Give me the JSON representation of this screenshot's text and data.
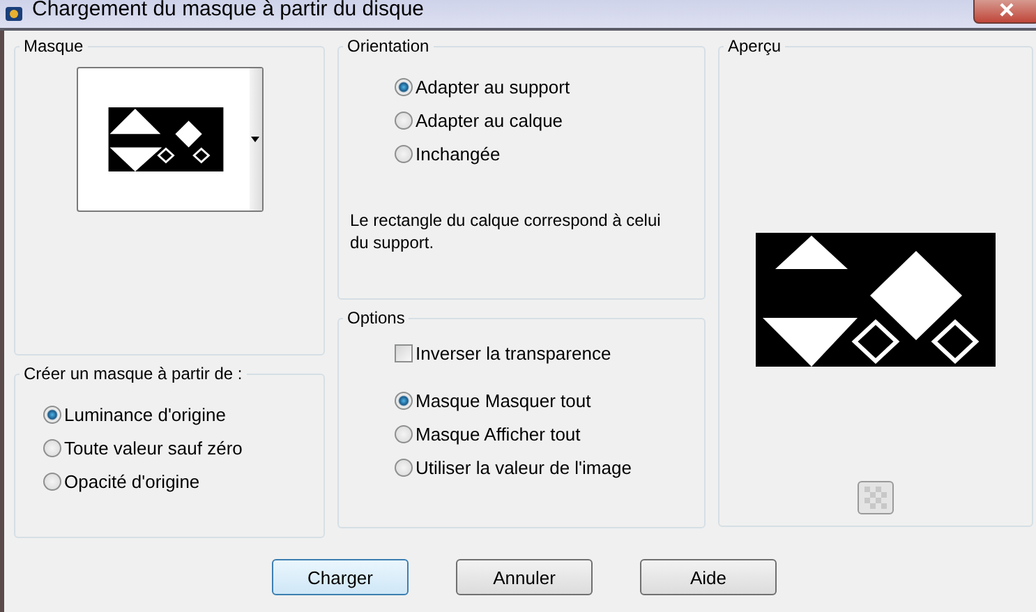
{
  "window": {
    "title": "Chargement du masque à partir du disque"
  },
  "mask": {
    "title": "Masque"
  },
  "source": {
    "title": "Créer un masque à partir de :",
    "options": [
      {
        "label": "Luminance d'origine",
        "selected": true
      },
      {
        "label": "Toute valeur sauf zéro",
        "selected": false
      },
      {
        "label": "Opacité d'origine",
        "selected": false
      }
    ]
  },
  "orientation": {
    "title": "Orientation",
    "options": [
      {
        "label": "Adapter au support",
        "selected": true
      },
      {
        "label": "Adapter au calque",
        "selected": false
      },
      {
        "label": "Inchangée",
        "selected": false
      }
    ],
    "note": "Le rectangle du calque correspond à celui du support."
  },
  "options": {
    "title": "Options",
    "invert": {
      "label": "Inverser la transparence",
      "checked": false
    },
    "modes": [
      {
        "label": "Masque Masquer tout",
        "selected": true
      },
      {
        "label": "Masque Afficher tout",
        "selected": false
      },
      {
        "label": "Utiliser la valeur de l'image",
        "selected": false
      }
    ]
  },
  "preview": {
    "title": "Aperçu"
  },
  "buttons": [
    {
      "label": "Charger",
      "focused": true
    },
    {
      "label": "Annuler",
      "focused": false
    },
    {
      "label": "Aide",
      "focused": false
    }
  ]
}
